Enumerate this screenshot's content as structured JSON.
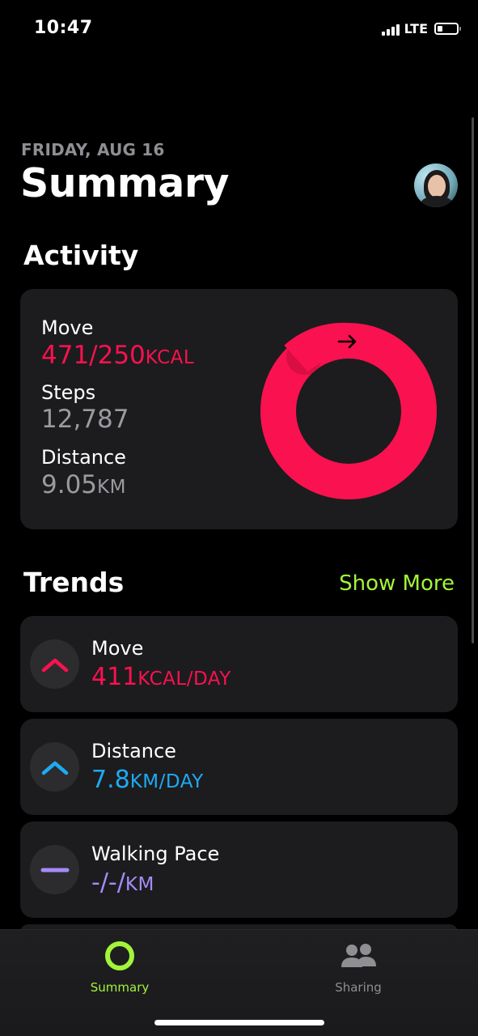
{
  "status_bar": {
    "time": "10:47",
    "network": "LTE"
  },
  "header": {
    "date": "FRIDAY, AUG 16",
    "title": "Summary"
  },
  "activity": {
    "section_title": "Activity",
    "move_label": "Move",
    "move_value": "471/250",
    "move_unit": "KCAL",
    "steps_label": "Steps",
    "steps_value": "12,787",
    "distance_label": "Distance",
    "distance_value": "9.05",
    "distance_unit": "KM",
    "ring_progress": 1.884
  },
  "trends": {
    "section_title": "Trends",
    "show_more": "Show More",
    "items": [
      {
        "label": "Move",
        "value": "411",
        "unit": "KCAL/DAY",
        "icon": "chevron-up-icon",
        "color": "#fa114f"
      },
      {
        "label": "Distance",
        "value": "7.8",
        "unit": "KM/DAY",
        "icon": "chevron-up-icon",
        "color": "#1eaaf1"
      },
      {
        "label": "Walking Pace",
        "value": "-/-/",
        "unit": "KM",
        "icon": "dash-icon",
        "color": "#a78bfa"
      }
    ]
  },
  "tabs": [
    {
      "label": "Summary",
      "icon": "activity-ring-icon",
      "active": true,
      "color": "#a3f43a"
    },
    {
      "label": "Sharing",
      "icon": "people-icon",
      "active": false,
      "color": "#8e8e93"
    }
  ],
  "colors": {
    "move": "#fa114f",
    "accent": "#a3f43a",
    "card": "#1c1c1e",
    "secondary": "#8e8e93"
  }
}
